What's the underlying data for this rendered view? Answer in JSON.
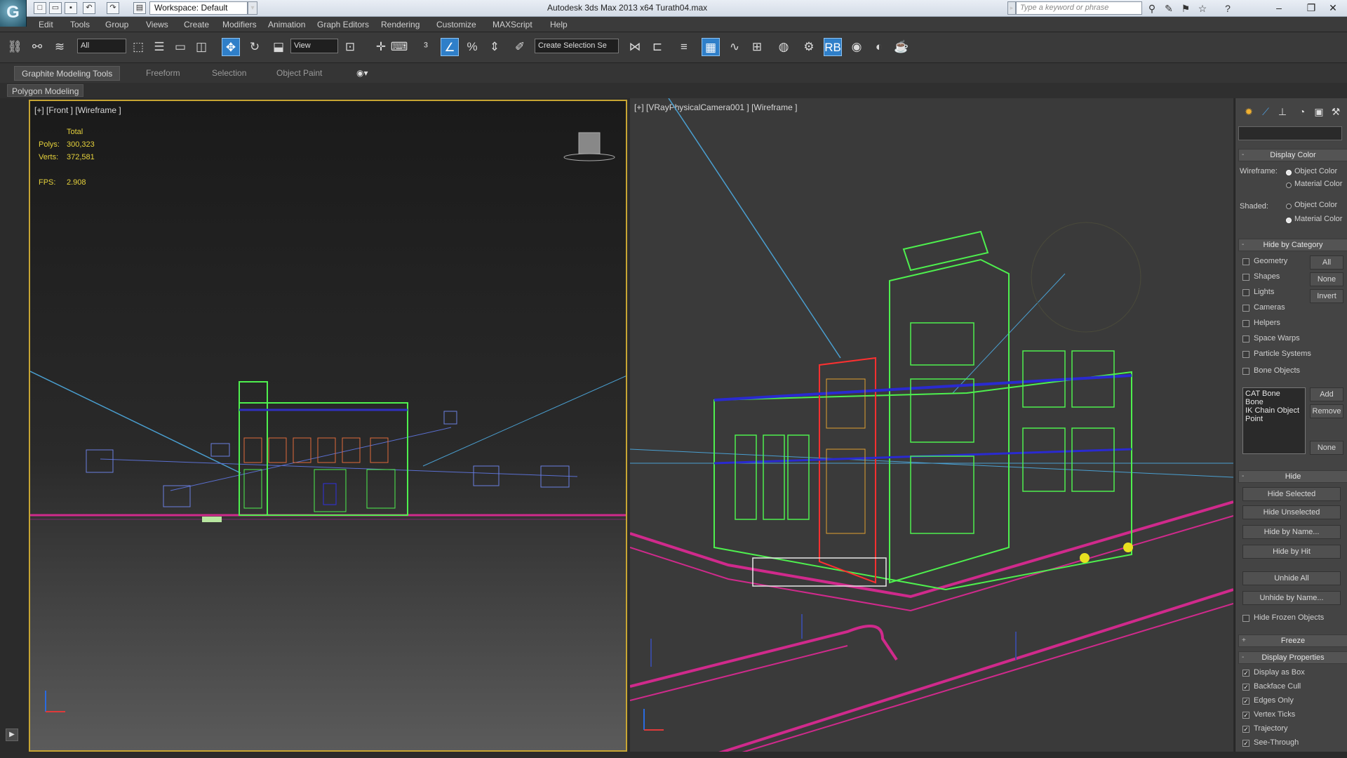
{
  "titlebar": {
    "workspace": "Workspace: Default",
    "app_title": "Autodesk 3ds Max  2013 x64      Turath04.max",
    "search_placeholder": "Type a keyword or phrase"
  },
  "menu": [
    "Edit",
    "Tools",
    "Group",
    "Views",
    "Create",
    "Modifiers",
    "Animation",
    "Graph Editors",
    "Rendering",
    "Customize",
    "MAXScript",
    "Help"
  ],
  "toolbar": {
    "selection_filter": "All",
    "ref_coord": "View",
    "named_selection": "Create Selection Se"
  },
  "ribbon": {
    "tabs": [
      "Graphite Modeling Tools",
      "Freeform",
      "Selection",
      "Object Paint"
    ],
    "panel": "Polygon Modeling"
  },
  "viewport_front": {
    "label": "[+] [Front ] [Wireframe ]",
    "stats": {
      "total_label": "Total",
      "polys_label": "Polys:",
      "polys": "300,323",
      "verts_label": "Verts:",
      "verts": "372,581",
      "fps_label": "FPS:",
      "fps": "2.908"
    }
  },
  "viewport_camera": {
    "label": "[+] [VRayPhysicalCamera001 ] [Wireframe ]"
  },
  "command_panel": {
    "display_color": {
      "title": "Display Color",
      "wireframe_label": "Wireframe:",
      "shaded_label": "Shaded:",
      "object_color": "Object Color",
      "material_color": "Material Color"
    },
    "hide_by_category": {
      "title": "Hide by Category",
      "items": [
        "Geometry",
        "Shapes",
        "Lights",
        "Cameras",
        "Helpers",
        "Space Warps",
        "Particle Systems",
        "Bone Objects"
      ],
      "buttons": [
        "All",
        "None",
        "Invert"
      ],
      "list": [
        "CAT Bone",
        "Bone",
        "IK Chain Object",
        "Point"
      ],
      "list_buttons": [
        "Add",
        "Remove",
        "None"
      ]
    },
    "hide": {
      "title": "Hide",
      "buttons": [
        "Hide Selected",
        "Hide Unselected",
        "Hide by Name...",
        "Hide by Hit",
        "Unhide All",
        "Unhide by Name..."
      ],
      "frozen_label": "Hide Frozen Objects"
    },
    "freeze": {
      "title": "Freeze"
    },
    "display_properties": {
      "title": "Display Properties",
      "items": [
        "Display as Box",
        "Backface Cull",
        "Edges Only",
        "Vertex Ticks",
        "Trajectory",
        "See-Through"
      ]
    }
  }
}
